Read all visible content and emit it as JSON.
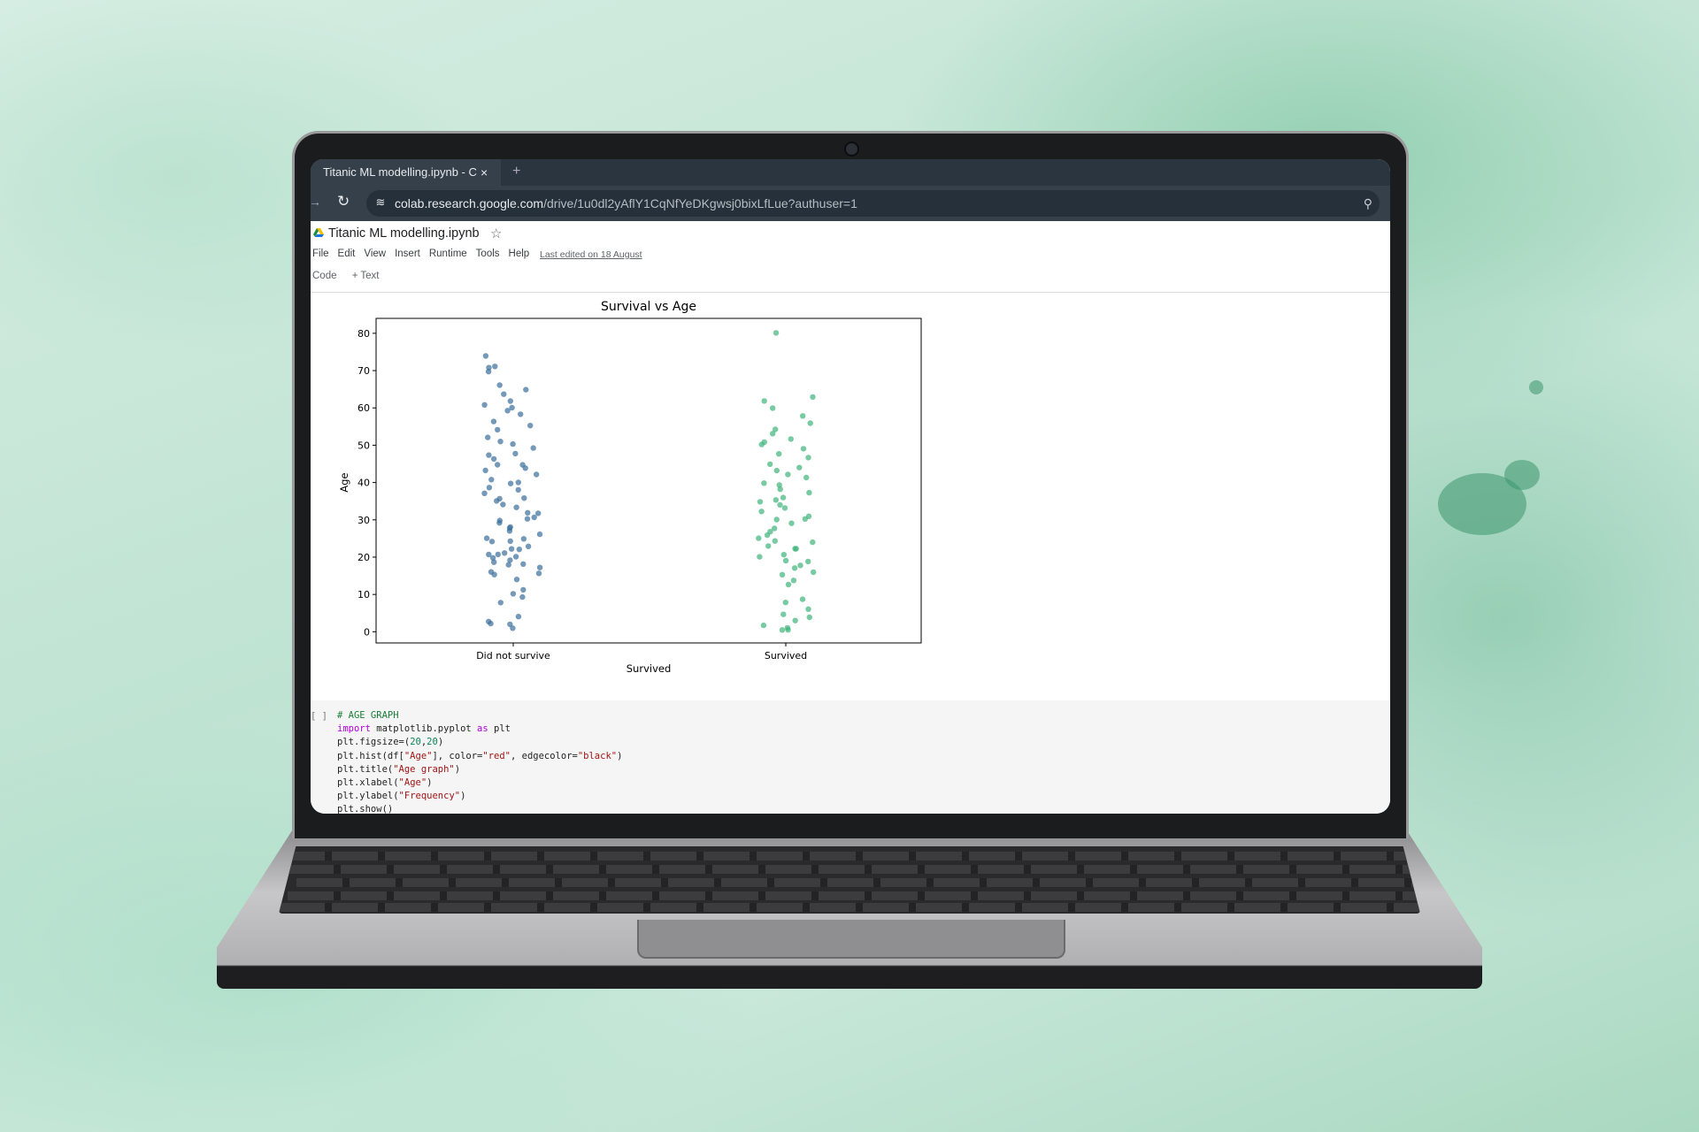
{
  "browser": {
    "tab_title": "Titanic ML modelling.ipynb - C",
    "tab_close": "×",
    "new_tab": "+",
    "url_host": "colab.research.google.com",
    "url_path": "/drive/1u0dl2yAflY1CqNfYeDKgwsj0bixLfLue?authuser=1"
  },
  "colab": {
    "title": "Titanic ML modelling.ipynb",
    "menu": [
      "File",
      "Edit",
      "View",
      "Insert",
      "Runtime",
      "Tools",
      "Help"
    ],
    "last_edited": "Last edited on 18 August",
    "toolbar": {
      "code": "Code",
      "text": "+ Text"
    }
  },
  "chart_data": {
    "type": "scatter",
    "title": "Survival vs Age",
    "xlabel": "Survived",
    "ylabel": "Age",
    "categories": [
      "Did not survive",
      "Survived"
    ],
    "ylim": [
      -3,
      84
    ],
    "yticks": [
      0,
      10,
      20,
      30,
      40,
      50,
      60,
      70,
      80
    ],
    "grid": false,
    "colors": {
      "Did not survive": "#3b6e9a",
      "Survived": "#3db37a"
    },
    "series": [
      {
        "name": "Did not survive",
        "values": [
          1,
          2,
          2,
          3,
          4,
          8,
          9,
          10,
          11,
          14,
          15,
          16,
          16,
          17,
          18,
          18,
          19,
          19,
          20,
          20,
          21,
          21,
          21,
          22,
          22,
          23,
          24,
          24,
          25,
          25,
          26,
          27,
          28,
          28,
          29,
          30,
          30,
          31,
          32,
          32,
          33,
          34,
          35,
          36,
          36,
          37,
          38,
          39,
          40,
          40,
          41,
          42,
          43,
          44,
          45,
          45,
          46,
          47,
          48,
          49,
          50,
          51,
          52,
          54,
          55,
          56,
          58,
          59,
          60,
          61,
          62,
          64,
          65,
          66,
          70,
          70.5,
          71,
          74
        ]
      },
      {
        "name": "Survived",
        "values": [
          0.4,
          0.8,
          1,
          2,
          3,
          4,
          5,
          6,
          8,
          9,
          13,
          14,
          15,
          16,
          17,
          18,
          19,
          19,
          20,
          21,
          22,
          22,
          23,
          24,
          24,
          25,
          26,
          27,
          28,
          29,
          30,
          30,
          31,
          32,
          33,
          34,
          35,
          35,
          36,
          37,
          38,
          39,
          40,
          41,
          42,
          43,
          44,
          45,
          47,
          48,
          49,
          50,
          51,
          52,
          53,
          54,
          56,
          58,
          60,
          62,
          63,
          80
        ]
      }
    ]
  },
  "code_cell": {
    "bracket": "[ ]"
  }
}
